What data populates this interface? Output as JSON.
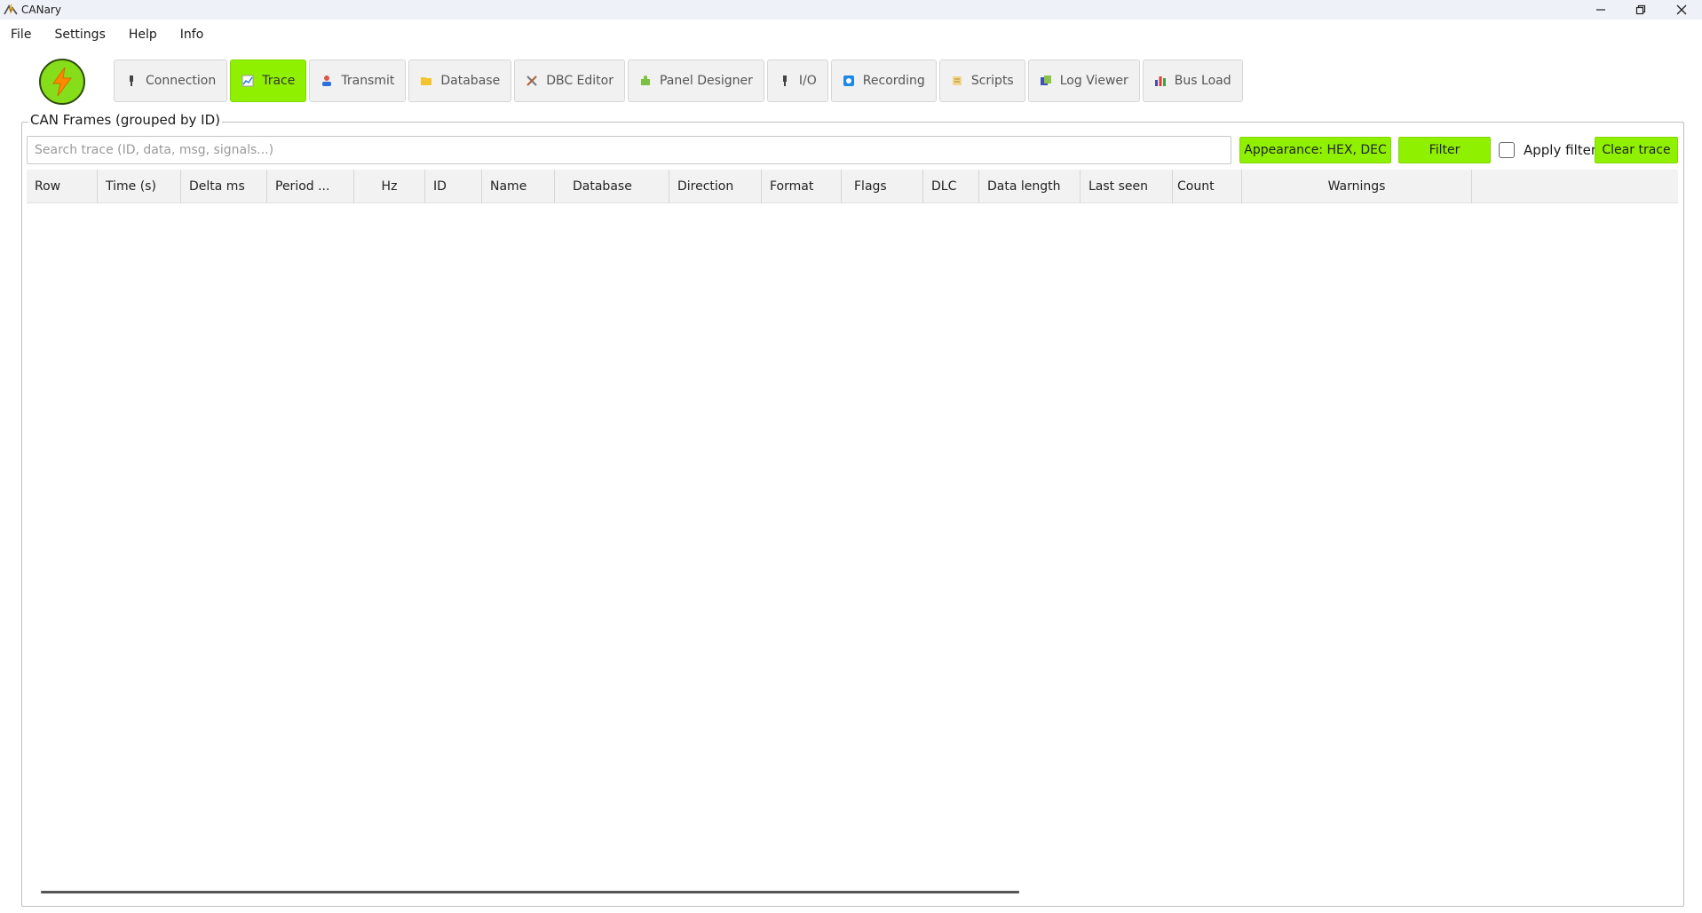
{
  "window": {
    "title": "CANary"
  },
  "menu": [
    "File",
    "Settings",
    "Help",
    "Info"
  ],
  "tabs": [
    {
      "label": "Connection",
      "icon": "plug-icon",
      "active": false
    },
    {
      "label": "Trace",
      "icon": "chart-icon",
      "active": true
    },
    {
      "label": "Transmit",
      "icon": "person-icon",
      "active": false
    },
    {
      "label": "Database",
      "icon": "folder-icon",
      "active": false
    },
    {
      "label": "DBC Editor",
      "icon": "tools-icon",
      "active": false
    },
    {
      "label": "Panel Designer",
      "icon": "puzzle-icon",
      "active": false
    },
    {
      "label": "I/O",
      "icon": "plug-icon",
      "active": false
    },
    {
      "label": "Recording",
      "icon": "record-icon",
      "active": false
    },
    {
      "label": "Scripts",
      "icon": "scroll-icon",
      "active": false
    },
    {
      "label": "Log Viewer",
      "icon": "log-icon",
      "active": false
    },
    {
      "label": "Bus Load",
      "icon": "bar-chart-icon",
      "active": false
    }
  ],
  "trace": {
    "group_title": "CAN Frames (grouped by ID)",
    "search_placeholder": "Search trace (ID, data, msg, signals...)",
    "search_value": "",
    "appearance_label": "Appearance: HEX, DEC",
    "filter_label": "Filter",
    "apply_filter_label": "Apply filter",
    "apply_filter_checked": false,
    "clear_label": "Clear trace",
    "columns": [
      "Row",
      "Time (s)",
      "Delta ms",
      "Period ...",
      "Hz",
      "ID",
      "Name",
      "Database",
      "Direction",
      "Format",
      "Flags",
      "DLC",
      "Data length",
      "Last seen",
      "Count",
      "Warnings"
    ],
    "rows": []
  },
  "colors": {
    "accent": "#8ff000",
    "logo_fill": "#86dd1a",
    "bolt": "#ff8a00"
  }
}
